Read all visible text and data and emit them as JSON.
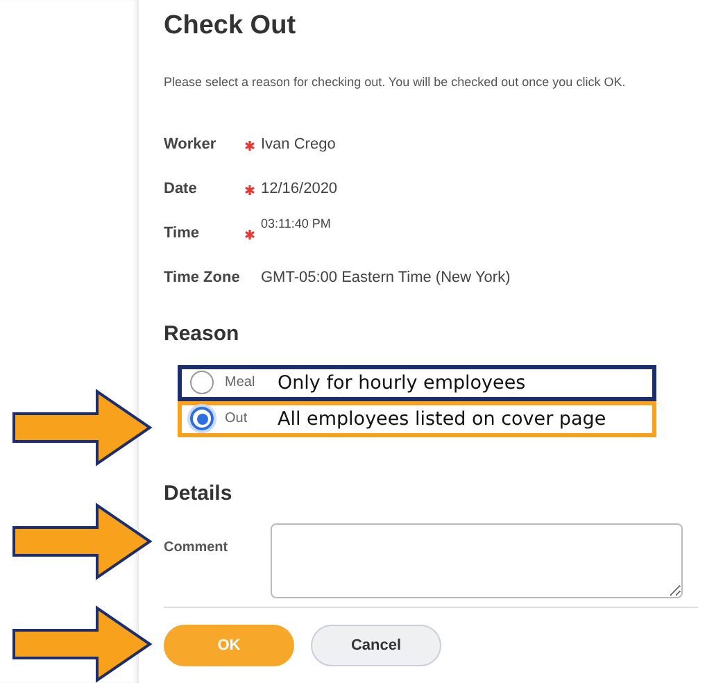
{
  "title": "Check Out",
  "instruction": "Please select a reason for checking out. You will be checked out once you click OK.",
  "fields": [
    {
      "label": "Worker",
      "required": true,
      "value": "Ivan Crego",
      "kind": "text"
    },
    {
      "label": "Date",
      "required": true,
      "value": "12/16/2020",
      "kind": "text"
    },
    {
      "label": "Time",
      "required": true,
      "value": "03:11:40 PM",
      "kind": "time"
    },
    {
      "label": "Time Zone",
      "required": false,
      "value": "GMT-05:00 Eastern Time (New York)",
      "kind": "text"
    }
  ],
  "reason": {
    "heading": "Reason",
    "options": [
      {
        "label": "Meal",
        "selected": false,
        "note": "Only for hourly employees",
        "color": "#1b2e6e"
      },
      {
        "label": "Out",
        "selected": true,
        "note": "All employees listed on cover page",
        "color": "#f7a11c"
      }
    ]
  },
  "details": {
    "heading": "Details",
    "comment_label": "Comment"
  },
  "buttons": [
    {
      "label": "OK",
      "kind": "primary"
    },
    {
      "label": "Cancel",
      "kind": "secondary"
    }
  ]
}
